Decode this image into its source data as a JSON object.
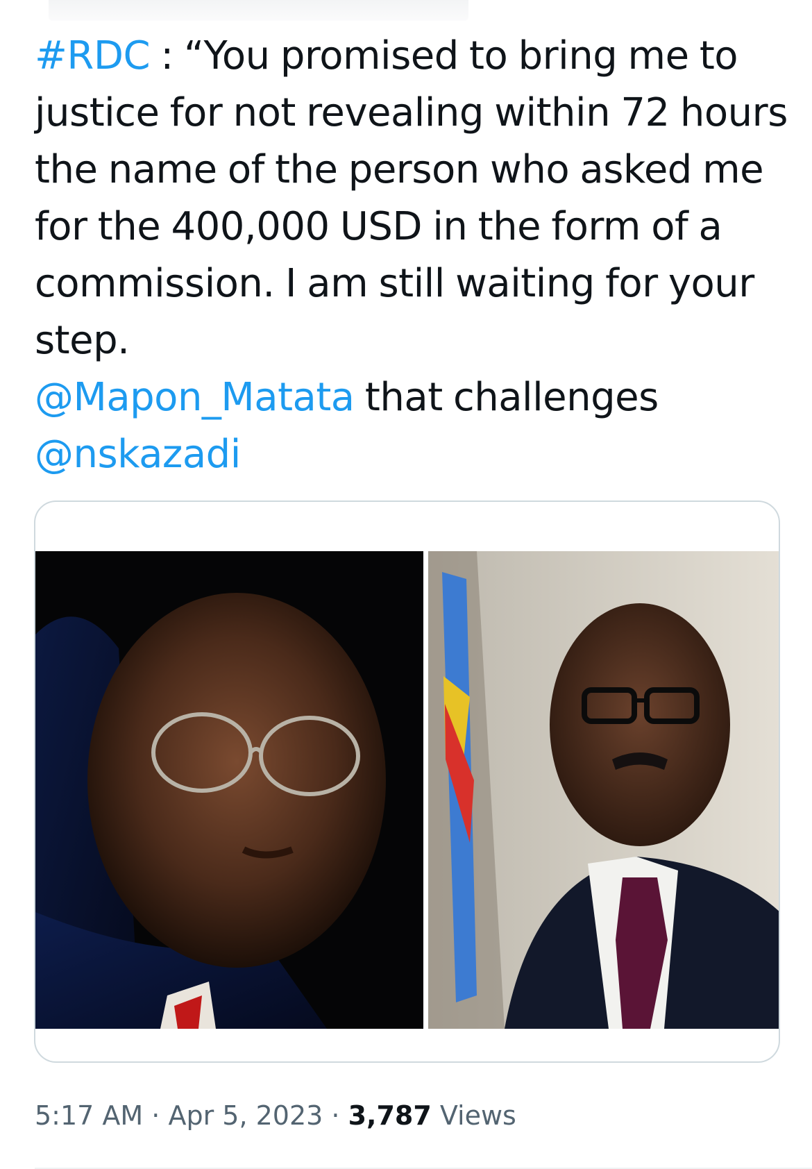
{
  "tweet": {
    "hashtag": "#RDC",
    "separator": " : ",
    "quote": "“You promised to bring me to justice for not revealing within 72 hours the name of the person who asked me for the 400,000 USD in the form of a commission. I am still waiting for your step.",
    "mention_1": "@Mapon_Matata",
    "connector": " that challenges ",
    "mention_2": "@nskazadi"
  },
  "meta": {
    "time": "5:17 AM",
    "dot": " · ",
    "date": "Apr 5, 2023",
    "views_count": "3,787",
    "views_label": " Views"
  },
  "colors": {
    "link": "#1d9bf0",
    "text": "#0f1419",
    "secondary": "#536471",
    "border": "#cfd9de"
  }
}
